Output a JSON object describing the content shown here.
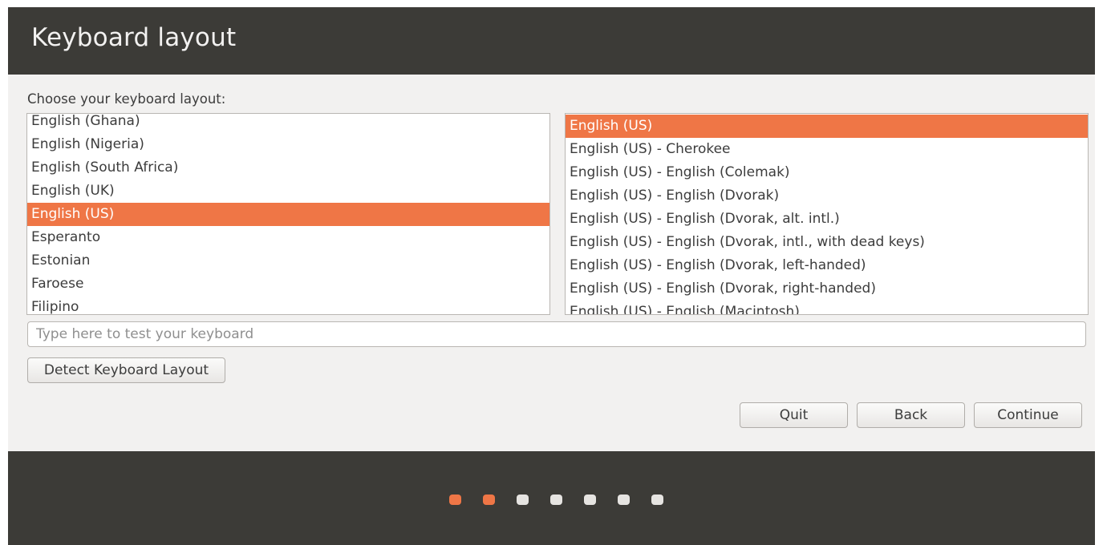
{
  "window": {
    "title": "Keyboard layout"
  },
  "prompt": "Choose your keyboard layout:",
  "layouts": [
    "English (Ghana)",
    "English (Nigeria)",
    "English (South Africa)",
    "English (UK)",
    "English (US)",
    "Esperanto",
    "Estonian",
    "Faroese",
    "Filipino"
  ],
  "layouts_selected": "English (US)",
  "variants": [
    "English (US)",
    "English (US) - Cherokee",
    "English (US) - English (Colemak)",
    "English (US) - English (Dvorak)",
    "English (US) - English (Dvorak, alt. intl.)",
    "English (US) - English (Dvorak, intl., with dead keys)",
    "English (US) - English (Dvorak, left-handed)",
    "English (US) - English (Dvorak, right-handed)",
    "English (US) - English (Macintosh)"
  ],
  "variants_selected": "English (US)",
  "test_input": {
    "value": "",
    "placeholder": "Type here to test your keyboard"
  },
  "buttons": {
    "detect": "Detect Keyboard Layout",
    "quit": "Quit",
    "back": "Back",
    "continue": "Continue"
  },
  "progress": {
    "total_steps": 7,
    "current_step": 2
  },
  "colors": {
    "accent": "#ef7646",
    "header": "#3c3b37"
  }
}
